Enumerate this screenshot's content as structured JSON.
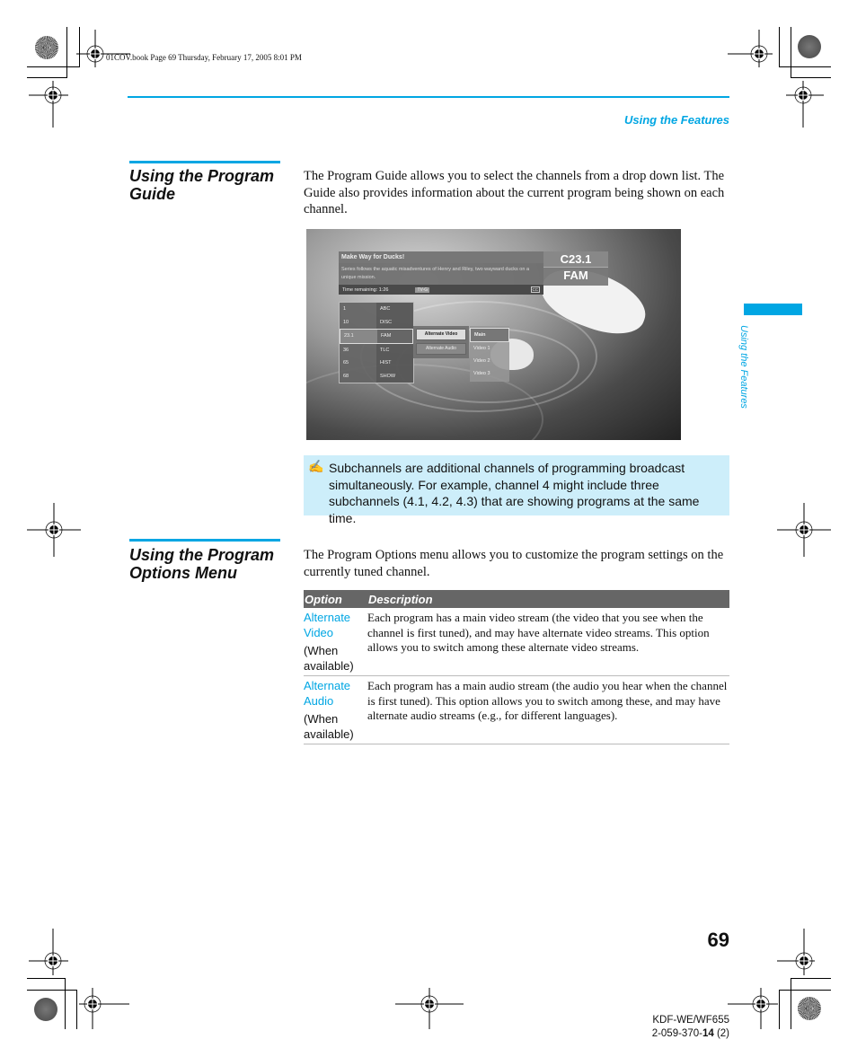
{
  "print_header": "01COV.book  Page 69  Thursday, February 17, 2005  8:01 PM",
  "running_head": "Using the Features",
  "side_tab_label": "Using the Features",
  "colors": {
    "accent": "#00a6e3",
    "note_bg": "#cdeefa",
    "table_header_bg": "#666666"
  },
  "sections": [
    {
      "title": "Using the Program Guide",
      "body": "The Program Guide allows you to select the channels from a drop down list. The Guide also provides information about the current program being shown on each channel."
    },
    {
      "title": "Using the Program Options Menu",
      "body": "The Program Options menu allows you to customize the program settings on the currently tuned channel."
    }
  ],
  "screenshot": {
    "program_title": "Make Way for Ducks!",
    "program_desc": "Series follows the aquatic misadventures of Henry and Riley, two wayward ducks on a unique mission.",
    "time_remaining": "Time remaining: 1:26",
    "rating": "TV-G",
    "cc": "CC",
    "channel_number": "C23.1",
    "channel_name": "FAM",
    "channels": [
      {
        "num": "1",
        "name": "ABC"
      },
      {
        "num": "10",
        "name": "DISC"
      },
      {
        "num": "23.1",
        "name": "FAM"
      },
      {
        "num": "36",
        "name": "TLC"
      },
      {
        "num": "65",
        "name": "HIST"
      },
      {
        "num": "68",
        "name": "SHOW"
      }
    ],
    "options": [
      "Alternate Video",
      "Alternate Audio"
    ],
    "sub_options": [
      "Main",
      "Video 1",
      "Video 2",
      "Video 3"
    ]
  },
  "note": {
    "icon": "pencil-note-icon",
    "text": "Subchannels are additional channels of programming broadcast simultaneously. For example, channel 4 might include three subchannels (4.1, 4.2, 4.3) that are showing programs at the same time."
  },
  "table": {
    "headers": [
      "Option",
      "Description"
    ],
    "rows": [
      {
        "option": "Alternate Video",
        "qualifier": "(When available)",
        "description": "Each program has a main video stream (the video that you see when the channel is first tuned), and may have alternate video streams. This option allows you to switch among these alternate video streams."
      },
      {
        "option": "Alternate Audio",
        "qualifier": "(When available)",
        "description": "Each program has a main audio stream (the audio you hear when the channel is first tuned). This option allows you to switch among these, and may have alternate audio streams (e.g., for different languages)."
      }
    ]
  },
  "page_number": "69",
  "model": "KDF-WE/WF655",
  "part_number_prefix": "2-059-370-",
  "part_number_bold": "14",
  "part_number_suffix": " (2)"
}
